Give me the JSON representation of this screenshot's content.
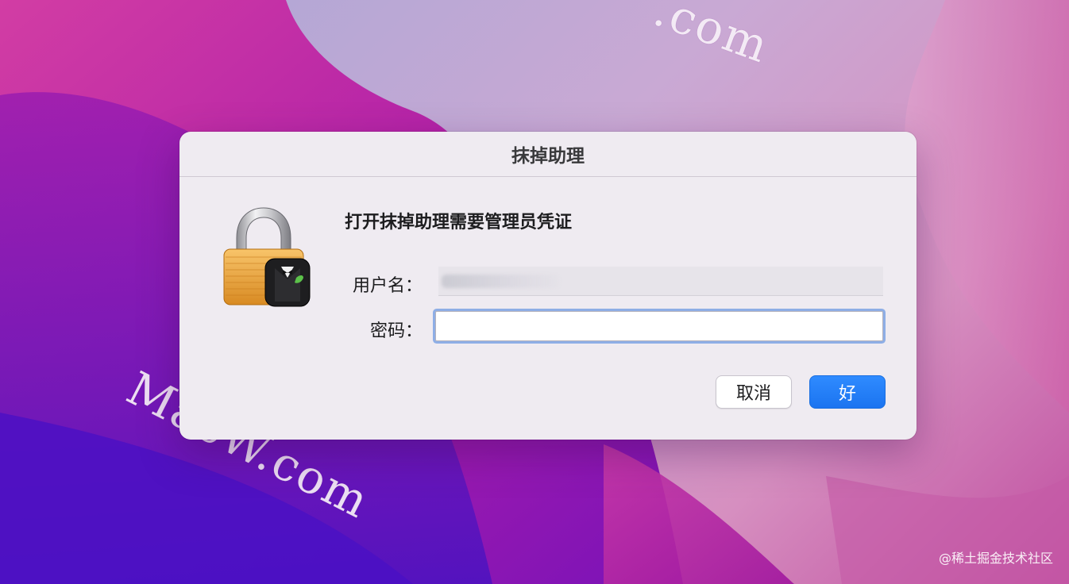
{
  "dialog": {
    "title": "抹掉助理",
    "heading": "打开抹掉助理需要管理员凭证",
    "username_label": "用户名：",
    "username_value_redacted": true,
    "password_label": "密码：",
    "password_value": "",
    "cancel_label": "取消",
    "ok_label": "好",
    "icon": "lock-with-butler-badge-icon"
  },
  "watermarks": {
    "macw_bottom": "MacW.com",
    "macw_top": ".com"
  },
  "credit": "@稀土掘金技术社区",
  "colors": {
    "accent": "#1b74f0",
    "focus_ring": "#8eaee6",
    "dialog_bg": "#efebf1"
  }
}
